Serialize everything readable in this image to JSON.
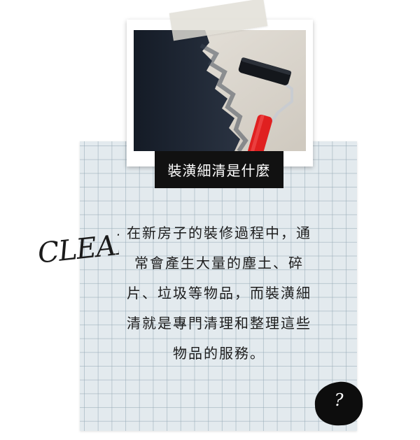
{
  "card": {
    "label": "裝潢細清是什麼",
    "script_word": "CLEAN",
    "body_lines": [
      "在新房子的裝修過程中，通",
      "常會產生大量的塵土、碎",
      "片、垃圾等物品，而裝潢細",
      "清就是專門清理和整理這些",
      "物品的服務。"
    ],
    "badge_symbol": "?"
  },
  "photo": {
    "icon": "paint-roller-icon"
  },
  "colors": {
    "grid_bg": "#e3eaee",
    "label_bg": "#111111",
    "roller_handle": "#e02020",
    "paint": "#1a2230"
  }
}
